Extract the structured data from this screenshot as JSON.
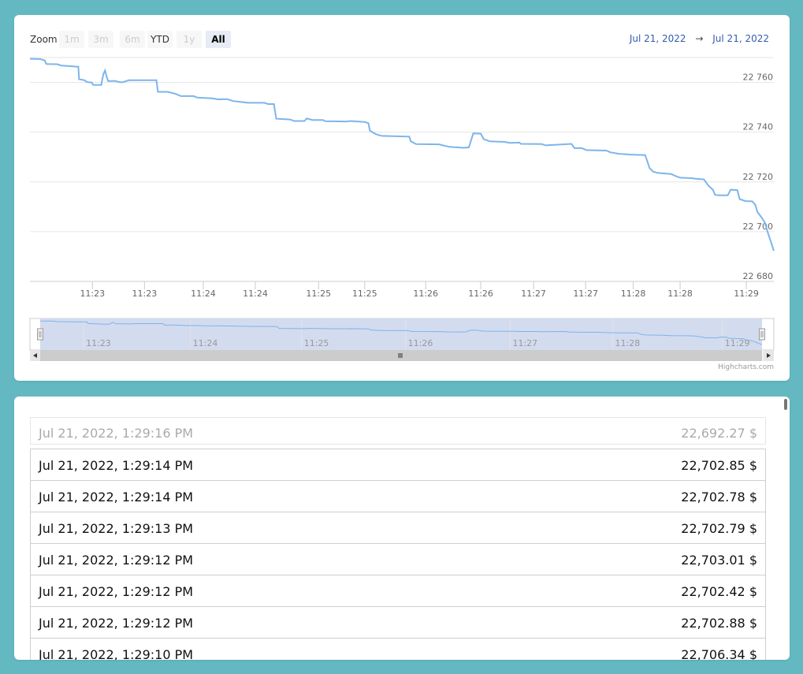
{
  "range_selector": {
    "zoom_label": "Zoom",
    "buttons": [
      {
        "label": "1m",
        "state": "disabled"
      },
      {
        "label": "3m",
        "state": "disabled"
      },
      {
        "label": "6m",
        "state": "disabled"
      },
      {
        "label": "YTD",
        "state": "enabled"
      },
      {
        "label": "1y",
        "state": "disabled"
      },
      {
        "label": "All",
        "state": "active"
      }
    ],
    "from_date": "Jul 21, 2022",
    "separator": "→",
    "to_date": "Jul 21, 2022"
  },
  "credits": "Highcharts.com",
  "chart_data": {
    "type": "line",
    "title": "",
    "xlabel": "",
    "ylabel": "",
    "x_ticks": [
      "11:23",
      "11:23",
      "11:24",
      "11:24",
      "11:25",
      "11:25",
      "11:26",
      "11:26",
      "11:27",
      "11:27",
      "11:28",
      "11:28",
      "11:29"
    ],
    "y_ticks": [
      "22 680",
      "22 700",
      "22 720",
      "22 740",
      "22 760"
    ],
    "ylim": [
      22680,
      22770
    ],
    "xlim": [
      0,
      100
    ],
    "grid": true,
    "line_color": "#7cb5ec",
    "series": [
      {
        "points": [
          [
            0,
            22769.5
          ],
          [
            1.4,
            22769.4
          ],
          [
            2,
            22768.8
          ],
          [
            2.2,
            22767.4
          ],
          [
            3.7,
            22767.3
          ],
          [
            4.2,
            22766.8
          ],
          [
            6.5,
            22766.3
          ],
          [
            6.6,
            22761.3
          ],
          [
            7.3,
            22760.9
          ],
          [
            7.7,
            22760.1
          ],
          [
            8.3,
            22760
          ],
          [
            8.5,
            22759
          ],
          [
            9.6,
            22759
          ],
          [
            9.7,
            22761
          ],
          [
            9.9,
            22763.6
          ],
          [
            10.1,
            22764.8
          ],
          [
            10.3,
            22762.5
          ],
          [
            10.5,
            22760.6
          ],
          [
            11.5,
            22760.6
          ],
          [
            12,
            22760.1
          ],
          [
            12.5,
            22760.1
          ],
          [
            13.3,
            22760.9
          ],
          [
            17,
            22760.9
          ],
          [
            17.2,
            22756.2
          ],
          [
            18.5,
            22756.2
          ],
          [
            19.5,
            22755.5
          ],
          [
            20.3,
            22754.5
          ],
          [
            22,
            22754.5
          ],
          [
            22.5,
            22753.9
          ],
          [
            24.5,
            22753.6
          ],
          [
            25.3,
            22753.2
          ],
          [
            26.5,
            22753.3
          ],
          [
            27.3,
            22752.5
          ],
          [
            28.3,
            22752.2
          ],
          [
            29.3,
            22751.8
          ],
          [
            31.5,
            22751.8
          ],
          [
            32,
            22751.3
          ],
          [
            32.8,
            22751.3
          ],
          [
            33.1,
            22745.4
          ],
          [
            35,
            22745.1
          ],
          [
            35.5,
            22744.5
          ],
          [
            36.9,
            22744.5
          ],
          [
            37.2,
            22745.5
          ],
          [
            38,
            22744.9
          ],
          [
            39.4,
            22744.9
          ],
          [
            39.7,
            22744.4
          ],
          [
            42.5,
            22744.3
          ],
          [
            43.1,
            22744.5
          ],
          [
            45,
            22744.1
          ],
          [
            45.5,
            22743.6
          ],
          [
            45.7,
            22740.6
          ],
          [
            46.5,
            22739.2
          ],
          [
            47.3,
            22738.5
          ],
          [
            51,
            22738.2
          ],
          [
            51.2,
            22736.3
          ],
          [
            51.9,
            22735.2
          ],
          [
            55,
            22735.1
          ],
          [
            55.5,
            22734.7
          ],
          [
            56.4,
            22734.1
          ],
          [
            58.3,
            22733.7
          ],
          [
            59,
            22733.9
          ],
          [
            59.3,
            22736.7
          ],
          [
            59.6,
            22739.5
          ],
          [
            60.6,
            22739.4
          ],
          [
            61,
            22737.2
          ],
          [
            61.8,
            22736.3
          ],
          [
            63.8,
            22736.1
          ],
          [
            64.5,
            22735.7
          ],
          [
            65.8,
            22735.8
          ],
          [
            66,
            22735.3
          ],
          [
            68.8,
            22735.2
          ],
          [
            69.3,
            22734.7
          ],
          [
            72.8,
            22735.3
          ],
          [
            73.2,
            22733.6
          ],
          [
            74.2,
            22733.6
          ],
          [
            74.8,
            22732.8
          ],
          [
            77.5,
            22732.6
          ],
          [
            78,
            22731.9
          ],
          [
            79.2,
            22731.3
          ],
          [
            80.8,
            22731
          ],
          [
            82.7,
            22730.8
          ],
          [
            83.3,
            22725.5
          ],
          [
            83.8,
            22724.1
          ],
          [
            84.4,
            22723.6
          ],
          [
            86.2,
            22723.2
          ],
          [
            86.7,
            22722.5
          ],
          [
            87.4,
            22721.7
          ],
          [
            88.9,
            22721.5
          ],
          [
            89.5,
            22721.3
          ],
          [
            90.6,
            22721
          ],
          [
            91.2,
            22718.5
          ],
          [
            91.8,
            22716.9
          ],
          [
            92.1,
            22714.8
          ],
          [
            92.6,
            22714.6
          ],
          [
            93.8,
            22714.6
          ],
          [
            94.2,
            22716.9
          ],
          [
            95.1,
            22716.7
          ],
          [
            95.4,
            22713.1
          ],
          [
            96.2,
            22712.3
          ],
          [
            97.1,
            22712.2
          ],
          [
            97.5,
            22710.8
          ],
          [
            97.8,
            22707.9
          ],
          [
            98.4,
            22705.5
          ],
          [
            98.8,
            22703.6
          ],
          [
            99.2,
            22699.6
          ],
          [
            99.6,
            22696
          ],
          [
            100,
            22692.3
          ]
        ]
      }
    ],
    "navigator": {
      "x_ticks": [
        "11:23",
        "11:24",
        "11:25",
        "11:26",
        "11:27",
        "11:28",
        "11:29"
      ]
    }
  },
  "trades": [
    {
      "date": "Jul 21, 2022, 1:29:16 PM",
      "price": "22,692.27 $",
      "faded": true
    },
    {
      "date": "Jul 21, 2022, 1:29:14 PM",
      "price": "22,702.85 $"
    },
    {
      "date": "Jul 21, 2022, 1:29:14 PM",
      "price": "22,702.78 $"
    },
    {
      "date": "Jul 21, 2022, 1:29:13 PM",
      "price": "22,702.79 $"
    },
    {
      "date": "Jul 21, 2022, 1:29:12 PM",
      "price": "22,703.01 $"
    },
    {
      "date": "Jul 21, 2022, 1:29:12 PM",
      "price": "22,702.42 $"
    },
    {
      "date": "Jul 21, 2022, 1:29:12 PM",
      "price": "22,702.88 $"
    },
    {
      "date": "Jul 21, 2022, 1:29:10 PM",
      "price": "22,706.34 $"
    }
  ]
}
